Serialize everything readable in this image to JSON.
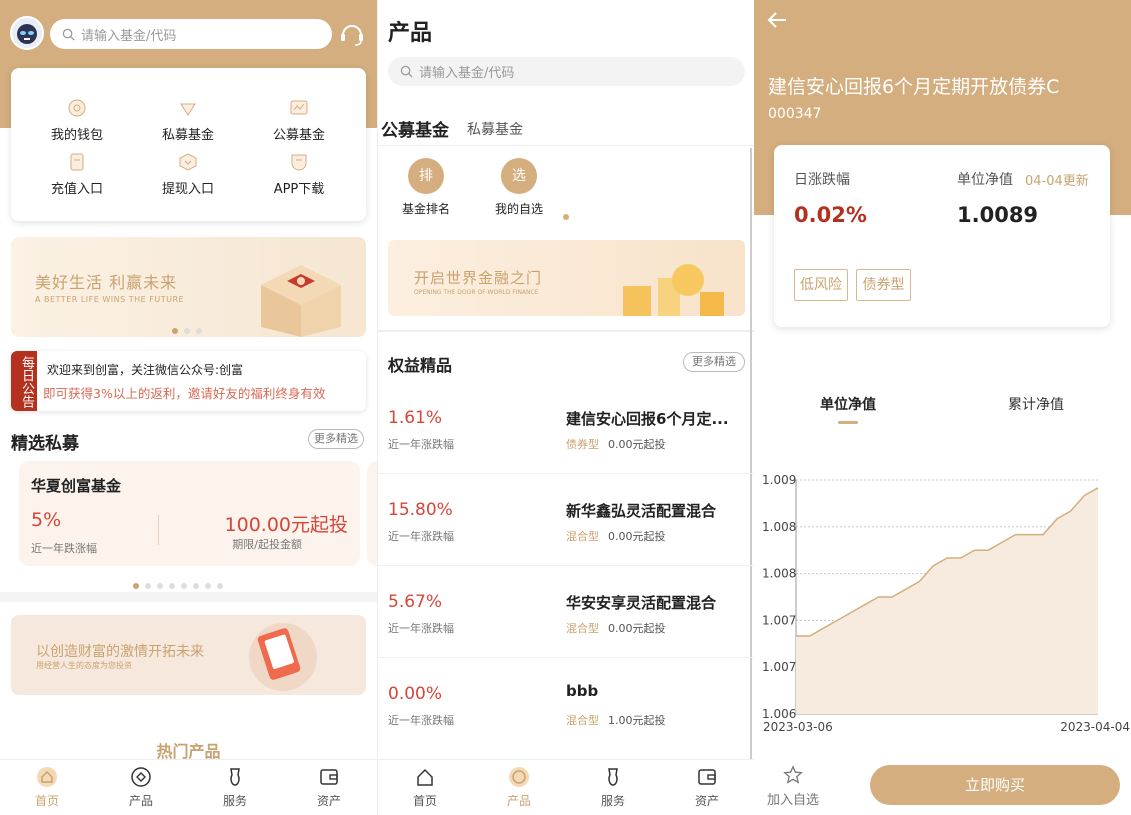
{
  "colors": {
    "brand": "#d4ae7e",
    "accent": "#c9a36f",
    "red": "#d6453a"
  },
  "home": {
    "search_placeholder": "请输入基金/代码",
    "shortcuts": [
      {
        "label": "我的钱包",
        "icon": "wallet-icon"
      },
      {
        "label": "私募基金",
        "icon": "diamond-icon"
      },
      {
        "label": "公募基金",
        "icon": "chart-icon"
      },
      {
        "label": "充值入口",
        "icon": "document-icon"
      },
      {
        "label": "提现入口",
        "icon": "box-icon"
      },
      {
        "label": "APP下载",
        "icon": "download-icon"
      }
    ],
    "banner": {
      "title": "美好生活 利赢未来",
      "subtitle": "A BETTER LIFE WINS THE FUTURE"
    },
    "notice": {
      "badge": "每日公告",
      "line1": "欢迎来到创富，关注微信公众号:创富",
      "line2": "即可获得3%以上的返利，邀请好友的福利终身有效"
    },
    "private_section": {
      "title": "精选私募",
      "more": "更多精选"
    },
    "private_card": {
      "name": "华夏创富基金",
      "rate": "5%",
      "rate_label": "近一年跌涨幅",
      "amount": "100.00元起投",
      "amount_label": "期限/起投金额"
    },
    "banner2": {
      "title": "以创造财富的激情开拓未来",
      "subtitle": "用经营人生的态度为您投资"
    },
    "hot_title": "热门产品"
  },
  "products": {
    "title": "产品",
    "search_placeholder": "请输入基金/代码",
    "tabs": [
      {
        "label": "公募基金"
      },
      {
        "label": "私募基金"
      }
    ],
    "quick": [
      {
        "glyph": "排",
        "label": "基金排名"
      },
      {
        "glyph": "选",
        "label": "我的自选"
      }
    ],
    "banner": {
      "title": "开启世界金融之门",
      "subtitle": "OPENING THE DOOR OF WORLD FINANCE"
    },
    "section": {
      "title": "权益精品",
      "more": "更多精选"
    },
    "funds": [
      {
        "rate": "1.61%",
        "rate_label": "近一年涨跌幅",
        "name": "建信安心回报6个月定...",
        "type": "债券型",
        "min": "0.00元起投"
      },
      {
        "rate": "15.80%",
        "rate_label": "近一年涨跌幅",
        "name": "新华鑫弘灵活配置混合",
        "type": "混合型",
        "min": "0.00元起投"
      },
      {
        "rate": "5.67%",
        "rate_label": "近一年涨跌幅",
        "name": "华安安享灵活配置混合",
        "type": "混合型",
        "min": "0.00元起投"
      },
      {
        "rate": "0.00%",
        "rate_label": "近一年涨跌幅",
        "name": "bbb",
        "type": "混合型",
        "min": "1.00元起投"
      }
    ]
  },
  "tabbar": [
    {
      "label": "首页",
      "icon": "home-icon"
    },
    {
      "label": "产品",
      "icon": "product-icon"
    },
    {
      "label": "服务",
      "icon": "service-icon"
    },
    {
      "label": "资产",
      "icon": "wallet-icon"
    }
  ],
  "detail": {
    "fund_name": "建信安心回报6个月定期开放债券C",
    "fund_code": "000347",
    "daily_label": "日涨跌幅",
    "daily_value": "0.02%",
    "nav_label": "单位净值",
    "nav_updated": "04-04更新",
    "nav_value": "1.0089",
    "tags": [
      "低风险",
      "债券型"
    ],
    "tabs": [
      {
        "label": "单位净值"
      },
      {
        "label": "累计净值"
      }
    ],
    "favorite_label": "加入自选",
    "buy_label": "立即购买"
  },
  "chart_data": {
    "type": "area",
    "title": "",
    "xlabel": "",
    "ylabel": "",
    "x_tick_labels": [
      "2023-03-06",
      "2023-04-04"
    ],
    "y_tick_labels": [
      "1.009",
      "1.008",
      "1.008",
      "1.007",
      "1.007",
      "1.006"
    ],
    "ylim": [
      1.006,
      1.009
    ],
    "grid": true,
    "series": [
      {
        "values": [
          1.007,
          1.007,
          1.0071,
          1.0072,
          1.0073,
          1.0074,
          1.0075,
          1.0075,
          1.0076,
          1.0077,
          1.0079,
          1.008,
          1.008,
          1.0081,
          1.0081,
          1.0082,
          1.0083,
          1.0083,
          1.0083,
          1.0085,
          1.0086,
          1.0088,
          1.0089
        ]
      }
    ]
  }
}
